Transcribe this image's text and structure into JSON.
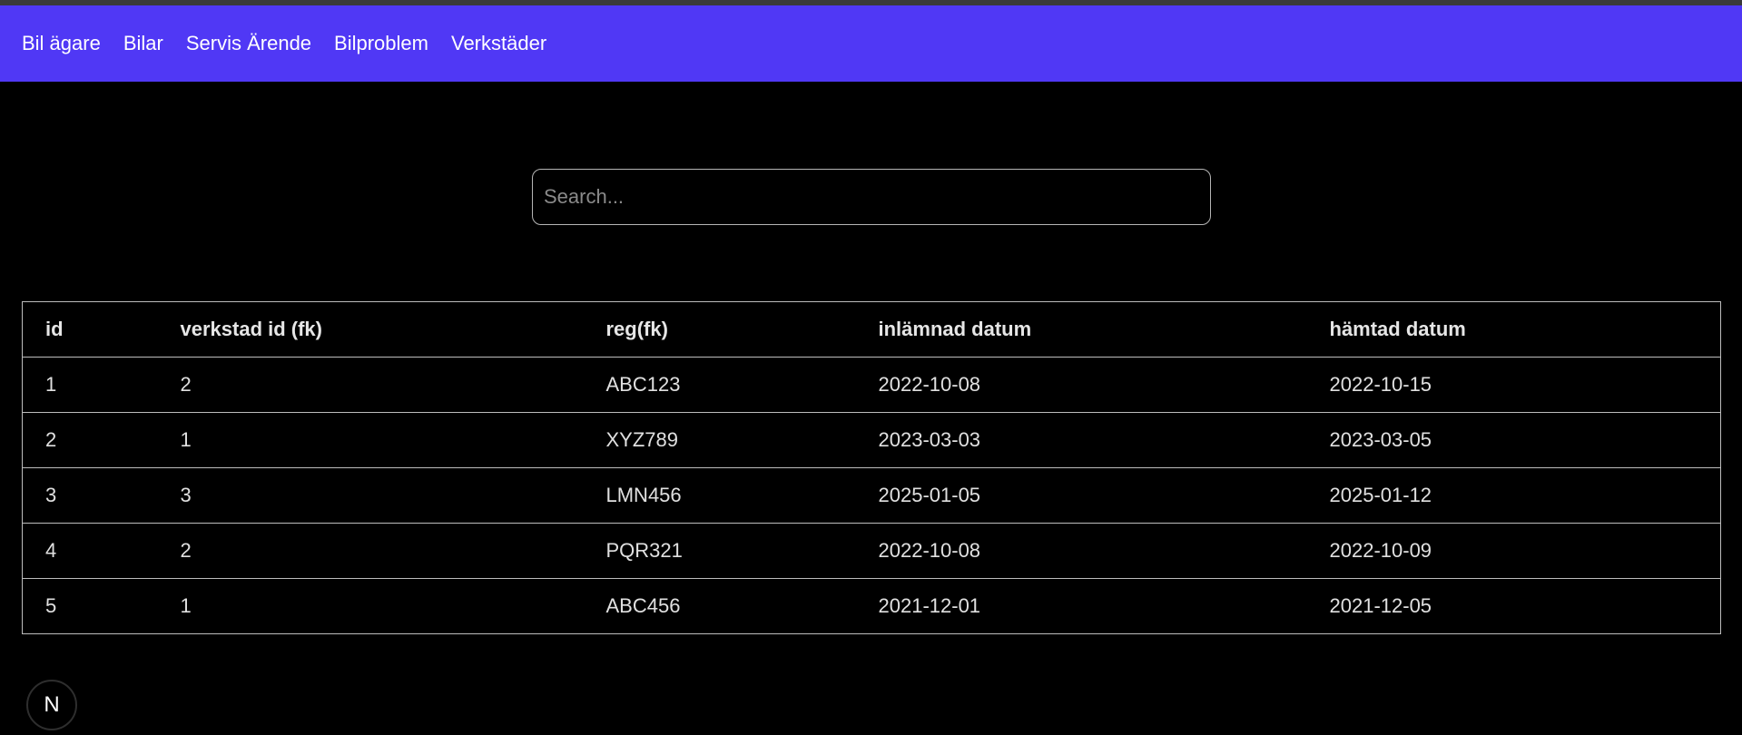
{
  "nav": {
    "items": [
      {
        "label": "Bil ägare"
      },
      {
        "label": "Bilar"
      },
      {
        "label": "Servis Ärende"
      },
      {
        "label": "Bilproblem"
      },
      {
        "label": "Verkstäder"
      }
    ]
  },
  "search": {
    "placeholder": "Search...",
    "value": ""
  },
  "table": {
    "headers": [
      "id",
      "verkstad id (fk)",
      "reg(fk)",
      "inlämnad datum",
      "hämtad datum"
    ],
    "rows": [
      [
        "1",
        "2",
        "ABC123",
        "2022-10-08",
        "2022-10-15"
      ],
      [
        "2",
        "1",
        "XYZ789",
        "2023-03-03",
        "2023-03-05"
      ],
      [
        "3",
        "3",
        "LMN456",
        "2025-01-05",
        "2025-01-12"
      ],
      [
        "4",
        "2",
        "PQR321",
        "2022-10-08",
        "2022-10-09"
      ],
      [
        "5",
        "1",
        "ABC456",
        "2021-12-01",
        "2021-12-05"
      ]
    ]
  },
  "badge": {
    "label": "N",
    "icon": "nextjs-logo-icon"
  },
  "colors": {
    "nav_background": "#5038f5",
    "page_background": "#000000",
    "border": "#bdbdbd"
  }
}
